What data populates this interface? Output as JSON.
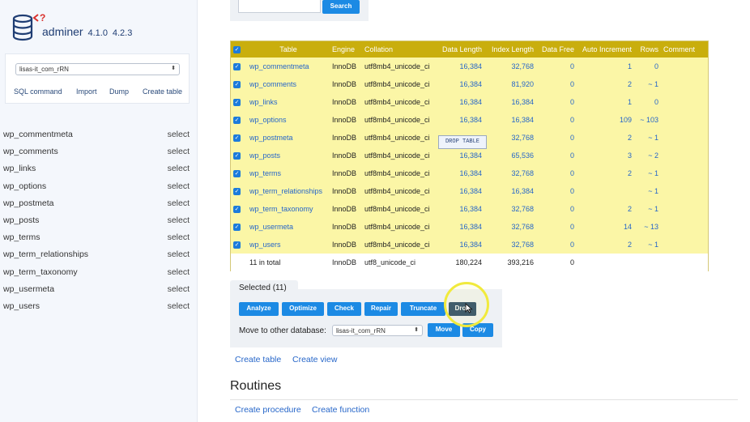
{
  "app": {
    "name": "adminer",
    "version_current": "4.1.0",
    "version_new": "4.2.3"
  },
  "sidebar": {
    "database": "lisas-it_com_rRN",
    "links": {
      "sql": "SQL command",
      "import": "Import",
      "dump": "Dump",
      "create": "Create table"
    },
    "select_label": "select",
    "tables": [
      "wp_commentmeta",
      "wp_comments",
      "wp_links",
      "wp_options",
      "wp_postmeta",
      "wp_posts",
      "wp_terms",
      "wp_term_relationships",
      "wp_term_taxonomy",
      "wp_usermeta",
      "wp_users"
    ]
  },
  "search": {
    "button": "Search"
  },
  "table": {
    "headers": [
      "Table",
      "Engine",
      "Collation",
      "Data Length",
      "Index Length",
      "Data Free",
      "Auto Increment",
      "Rows",
      "Comment"
    ],
    "rows": [
      {
        "name": "wp_commentmeta",
        "engine": "InnoDB",
        "collation": "utf8mb4_unicode_ci",
        "data": "16,384",
        "index": "32,768",
        "free": "0",
        "auto": "1",
        "rows": "0"
      },
      {
        "name": "wp_comments",
        "engine": "InnoDB",
        "collation": "utf8mb4_unicode_ci",
        "data": "16,384",
        "index": "81,920",
        "free": "0",
        "auto": "2",
        "rows": "~ 1"
      },
      {
        "name": "wp_links",
        "engine": "InnoDB",
        "collation": "utf8mb4_unicode_ci",
        "data": "16,384",
        "index": "16,384",
        "free": "0",
        "auto": "1",
        "rows": "0"
      },
      {
        "name": "wp_options",
        "engine": "InnoDB",
        "collation": "utf8mb4_unicode_ci",
        "data": "16,384",
        "index": "16,384",
        "free": "0",
        "auto": "109",
        "rows": "~ 103"
      },
      {
        "name": "wp_postmeta",
        "engine": "InnoDB",
        "collation": "utf8mb4_unicode_ci",
        "data": "",
        "index": "32,768",
        "free": "0",
        "auto": "2",
        "rows": "~ 1"
      },
      {
        "name": "wp_posts",
        "engine": "InnoDB",
        "collation": "utf8mb4_unicode_ci",
        "data": "16,384",
        "index": "65,536",
        "free": "0",
        "auto": "3",
        "rows": "~ 2"
      },
      {
        "name": "wp_terms",
        "engine": "InnoDB",
        "collation": "utf8mb4_unicode_ci",
        "data": "16,384",
        "index": "32,768",
        "free": "0",
        "auto": "2",
        "rows": "~ 1"
      },
      {
        "name": "wp_term_relationships",
        "engine": "InnoDB",
        "collation": "utf8mb4_unicode_ci",
        "data": "16,384",
        "index": "16,384",
        "free": "0",
        "auto": "",
        "rows": "~ 1"
      },
      {
        "name": "wp_term_taxonomy",
        "engine": "InnoDB",
        "collation": "utf8mb4_unicode_ci",
        "data": "16,384",
        "index": "32,768",
        "free": "0",
        "auto": "2",
        "rows": "~ 1"
      },
      {
        "name": "wp_usermeta",
        "engine": "InnoDB",
        "collation": "utf8mb4_unicode_ci",
        "data": "16,384",
        "index": "32,768",
        "free": "0",
        "auto": "14",
        "rows": "~ 13"
      },
      {
        "name": "wp_users",
        "engine": "InnoDB",
        "collation": "utf8mb4_unicode_ci",
        "data": "16,384",
        "index": "32,768",
        "free": "0",
        "auto": "2",
        "rows": "~ 1"
      }
    ],
    "total": {
      "label": "11 in total",
      "engine": "InnoDB",
      "collation": "utf8_unicode_ci",
      "data": "180,224",
      "index": "393,216",
      "free": "0"
    },
    "tooltip": "DROP TABLE"
  },
  "selected": {
    "label": "Selected (11)",
    "buttons": [
      "Analyze",
      "Optimize",
      "Check",
      "Repair",
      "Truncate",
      "Drop"
    ],
    "move_label": "Move to other database:",
    "move_db": "lisas-it_com_rRN",
    "move_button": "Move",
    "copy_button": "Copy"
  },
  "links": {
    "create_table": "Create table",
    "create_view": "Create view"
  },
  "routines": {
    "title": "Routines",
    "create_procedure": "Create procedure",
    "create_function": "Create function"
  },
  "colors": {
    "header": "#c9ae0d",
    "row": "#fbf6a6",
    "button": "#1c8ae4",
    "highlight": "#f1ea3c"
  }
}
